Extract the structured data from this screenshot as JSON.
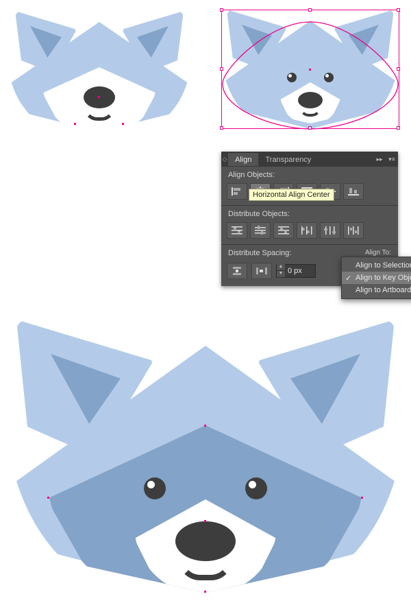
{
  "panel": {
    "tabs": {
      "align": "Align",
      "transparency": "Transparency"
    },
    "sections": {
      "alignObjects": "Align Objects:",
      "distributeObjects": "Distribute Objects:",
      "distributeSpacing": "Distribute Spacing:",
      "alignTo": "Align To:"
    },
    "tooltip": "Horizontal Align Center",
    "spacingValue": "0 px",
    "flyout": {
      "selection": "Align to Selection",
      "keyObject": "Align to Key Object",
      "artboard": "Align to Artboard"
    }
  },
  "icons": {
    "alignRow": [
      "align-left",
      "align-hcenter",
      "align-right",
      "align-top",
      "align-vcenter",
      "align-bottom"
    ],
    "distRow": [
      "dist-top",
      "dist-vcenter",
      "dist-bottom",
      "dist-left",
      "dist-hcenter",
      "dist-right"
    ],
    "spacingRow": [
      "dist-space-v",
      "dist-space-h"
    ]
  },
  "colors": {
    "light": "#b3cbe8",
    "dark": "#83a3c8",
    "charcoal": "#3d3d3d",
    "panel": "#535353",
    "magenta": "#ec008c"
  }
}
